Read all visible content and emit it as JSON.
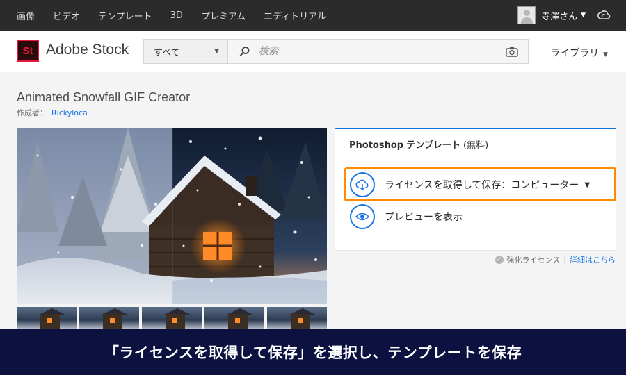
{
  "topnav": {
    "items": [
      "画像",
      "ビデオ",
      "テンプレート",
      "3D",
      "プレミアム",
      "エディトリアル"
    ],
    "username": "寺澤さん",
    "icons": [
      "user-avatar-icon",
      "chevron-down-icon",
      "creative-cloud-icon"
    ]
  },
  "header": {
    "logo_mark": "St",
    "logo_text": "Adobe Stock",
    "search": {
      "category": "すべて",
      "placeholder": "検索",
      "icons": [
        "search-icon",
        "camera-icon"
      ]
    },
    "library_label": "ライブラリ"
  },
  "asset": {
    "title": "Animated Snowfall GIF Creator",
    "author_label": "作成者：",
    "author_name": "Rickyloca",
    "thumbnail_count": 5
  },
  "panel": {
    "product": "Photoshop",
    "type_label": "テンプレート",
    "price": "(無料)",
    "license_action": "ライセンスを取得して保存：コンピューター",
    "preview_action": "プレビューを表示",
    "enhanced_license": "強化ライセンス",
    "details_link": "詳細はこちら"
  },
  "caption": "「ライセンスを取得して保存」を選択し、テンプレートを保存",
  "colors": {
    "accent_blue": "#1473e6",
    "highlight_orange": "#ff8a00",
    "nav_bg": "#2b2b2b",
    "banner_bg": "#0c1140",
    "logo_red": "#e8173d"
  }
}
